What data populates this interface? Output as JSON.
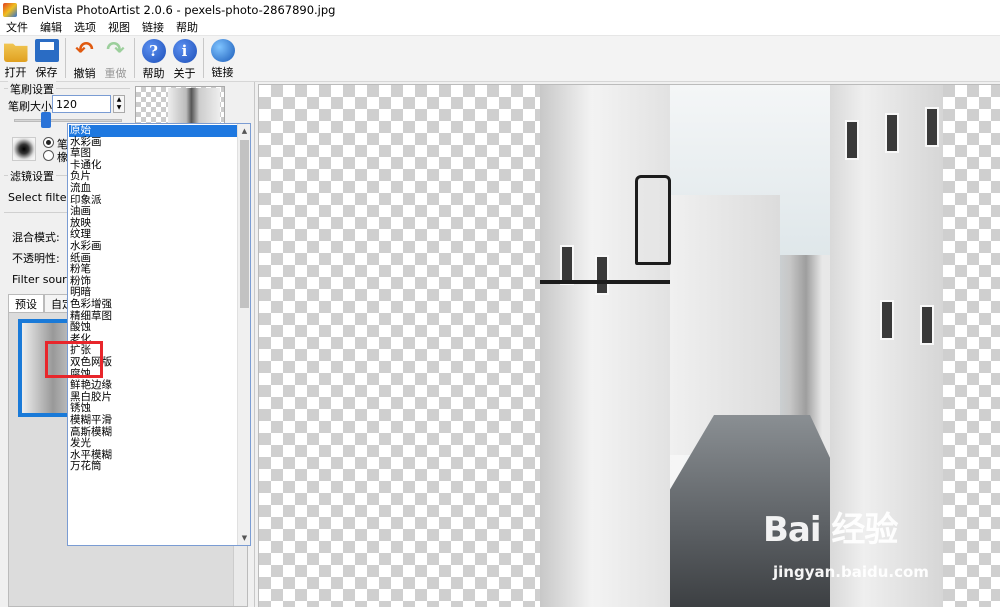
{
  "window": {
    "title": "BenVista PhotoArtist 2.0.6 - pexels-photo-2867890.jpg"
  },
  "menu": [
    "文件",
    "编辑",
    "选项",
    "视图",
    "链接",
    "帮助"
  ],
  "toolbar": {
    "open": "打开",
    "save": "保存",
    "undo": "撤销",
    "redo": "重做",
    "help": "帮助",
    "about": "关于",
    "link": "链接"
  },
  "brush_settings": {
    "title": "笔刷设置",
    "size_label": "笔刷大小:",
    "size_value": "120",
    "slider_value": 0.3,
    "mode_brush": "笔刷",
    "mode_eraser": "橡皮擦"
  },
  "filter_settings": {
    "title": "滤镜设置",
    "select_label": "Select filter:",
    "selected": "原始",
    "blend_label": "混合模式:",
    "opacity_label": "不透明性:",
    "source_label": "Filter source:"
  },
  "tabs": [
    "预设",
    "自定"
  ],
  "filter_list": [
    "原始",
    "水彩画",
    "草图",
    "卡通化",
    "负片",
    "流血",
    "印象派",
    "油画",
    "放映",
    "纹理",
    "水彩画",
    "纸画",
    "粉笔",
    "粉饰",
    "明暗",
    "色彩增强",
    "精细草图",
    "酸蚀",
    "老化",
    "扩张",
    "双色网版",
    "腐蚀",
    "鲜艳边缘",
    "黑白胶片",
    "锈蚀",
    "模糊平滑",
    "高斯模糊",
    "发光",
    "水平模糊",
    "万花筒"
  ],
  "watermark": {
    "brand": "Bai 经验",
    "url": "jingyan.baidu.com"
  },
  "colors": {
    "accent": "#1e78e0",
    "highlight": "#e8262b"
  }
}
